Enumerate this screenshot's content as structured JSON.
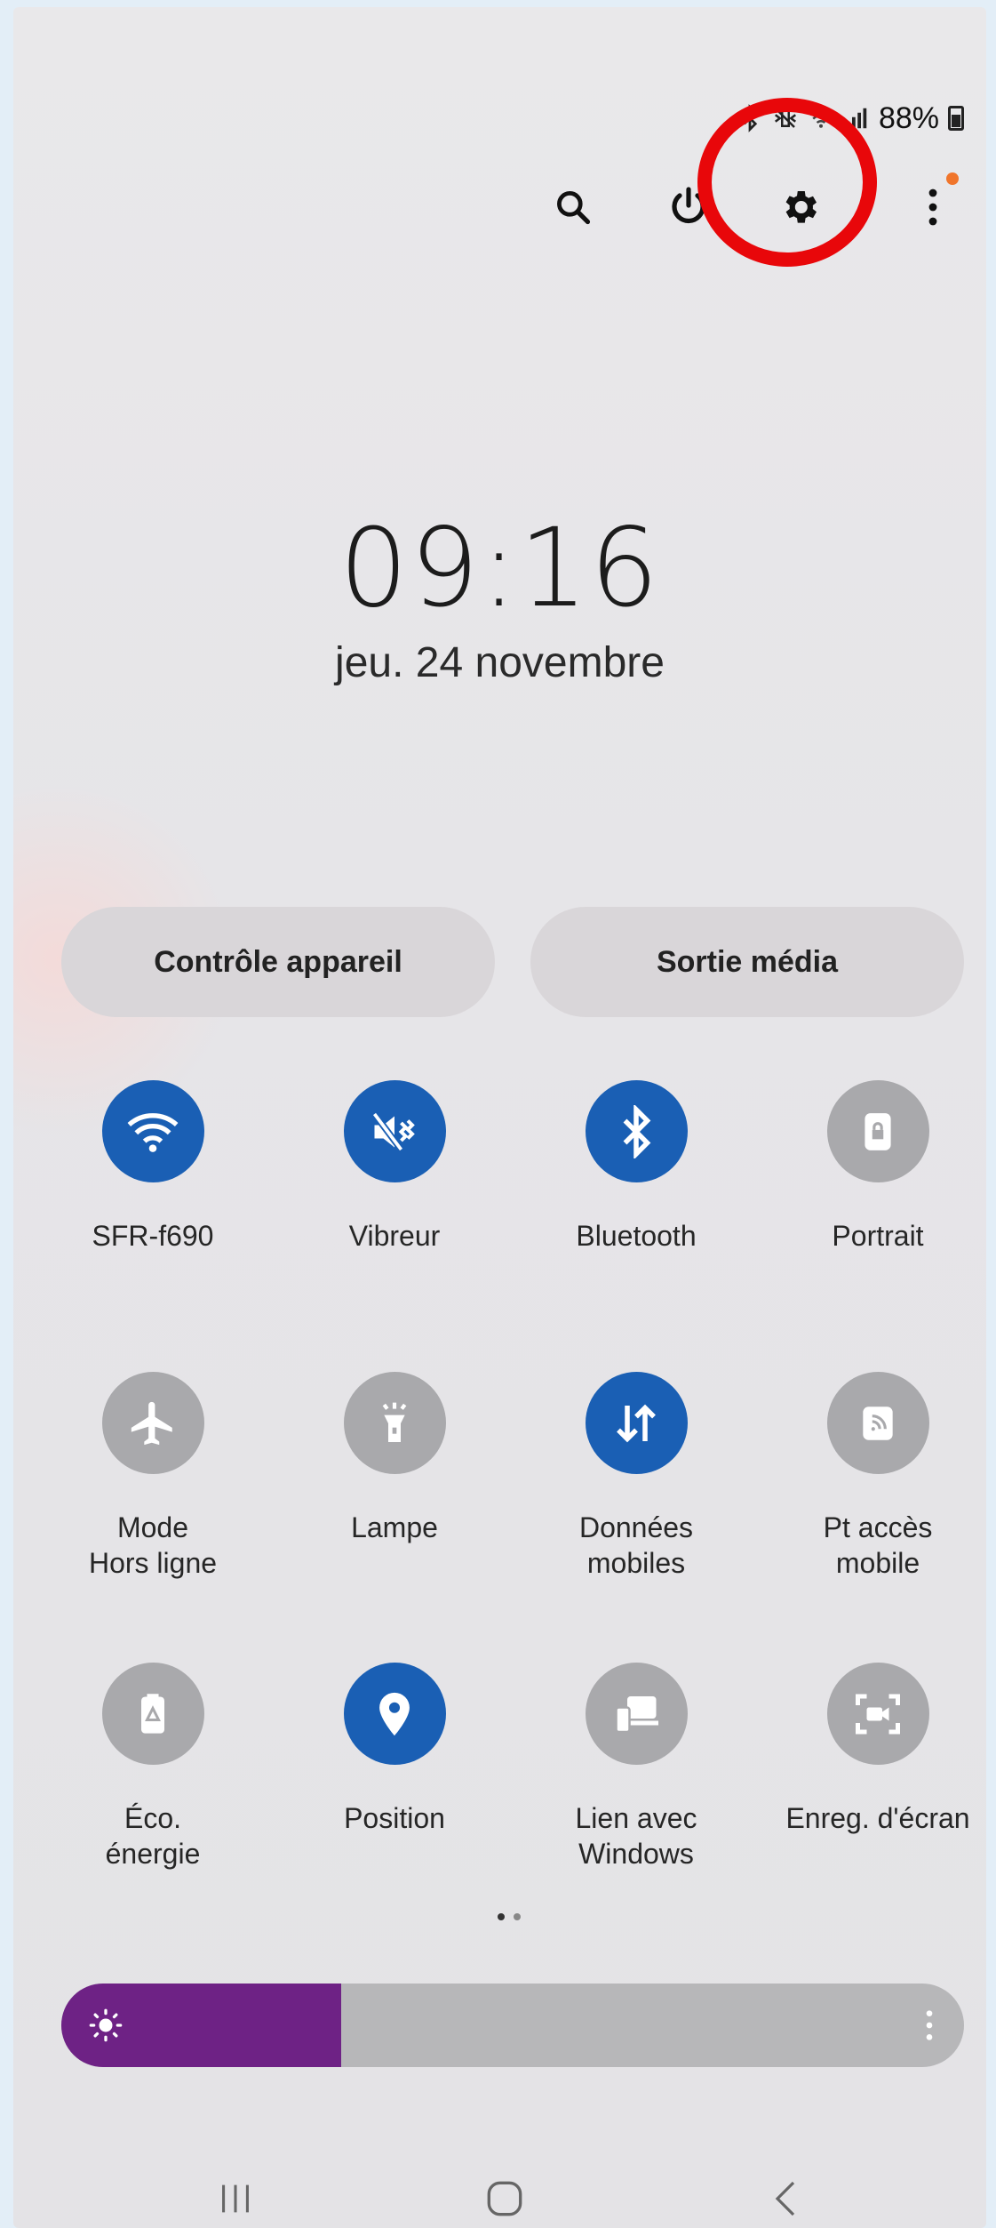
{
  "status_bar": {
    "battery_text": "88%",
    "icons": [
      "bluetooth-icon",
      "vibrate-icon",
      "wifi-icon",
      "signal-icon",
      "battery-icon"
    ]
  },
  "top_actions": [
    "search-icon",
    "power-icon",
    "settings-icon",
    "more-options-icon"
  ],
  "clock": {
    "time": "09:16",
    "date": "jeu. 24 novembre"
  },
  "buttons": {
    "device_control": "Contrôle appareil",
    "media_output": "Sortie média"
  },
  "tiles": [
    {
      "label": "SFR-f690",
      "icon": "wifi-icon",
      "active": true
    },
    {
      "label": "Vibreur",
      "icon": "vibrate-icon",
      "active": true
    },
    {
      "label": "Bluetooth",
      "icon": "bluetooth-icon",
      "active": true
    },
    {
      "label": "Portrait",
      "icon": "portrait-lock-icon",
      "active": false
    },
    {
      "label": "Mode\nHors ligne",
      "icon": "airplane-icon",
      "active": false
    },
    {
      "label": "Lampe",
      "icon": "flashlight-icon",
      "active": false
    },
    {
      "label": "Données\nmobiles",
      "icon": "mobile-data-icon",
      "active": true
    },
    {
      "label": "Pt accès\nmobile",
      "icon": "hotspot-icon",
      "active": false
    },
    {
      "label": "Éco.\nénergie",
      "icon": "power-saving-icon",
      "active": false
    },
    {
      "label": "Position",
      "icon": "location-icon",
      "active": true
    },
    {
      "label": "Lien avec\nWindows",
      "icon": "link-to-windows-icon",
      "active": false
    },
    {
      "label": "Enreg. d'écran",
      "icon": "screen-recorder-icon",
      "active": false
    }
  ],
  "pagination": {
    "pages": 2,
    "current": 1
  },
  "brightness": {
    "level": 0.31
  },
  "nav_bar": [
    "recent-apps-icon",
    "home-icon",
    "back-icon"
  ],
  "colors": {
    "active_tile": "#1a5fb4",
    "inactive_tile": "#a9a9ac",
    "brightness": "#6e2285",
    "annotation": "#e8070a"
  }
}
